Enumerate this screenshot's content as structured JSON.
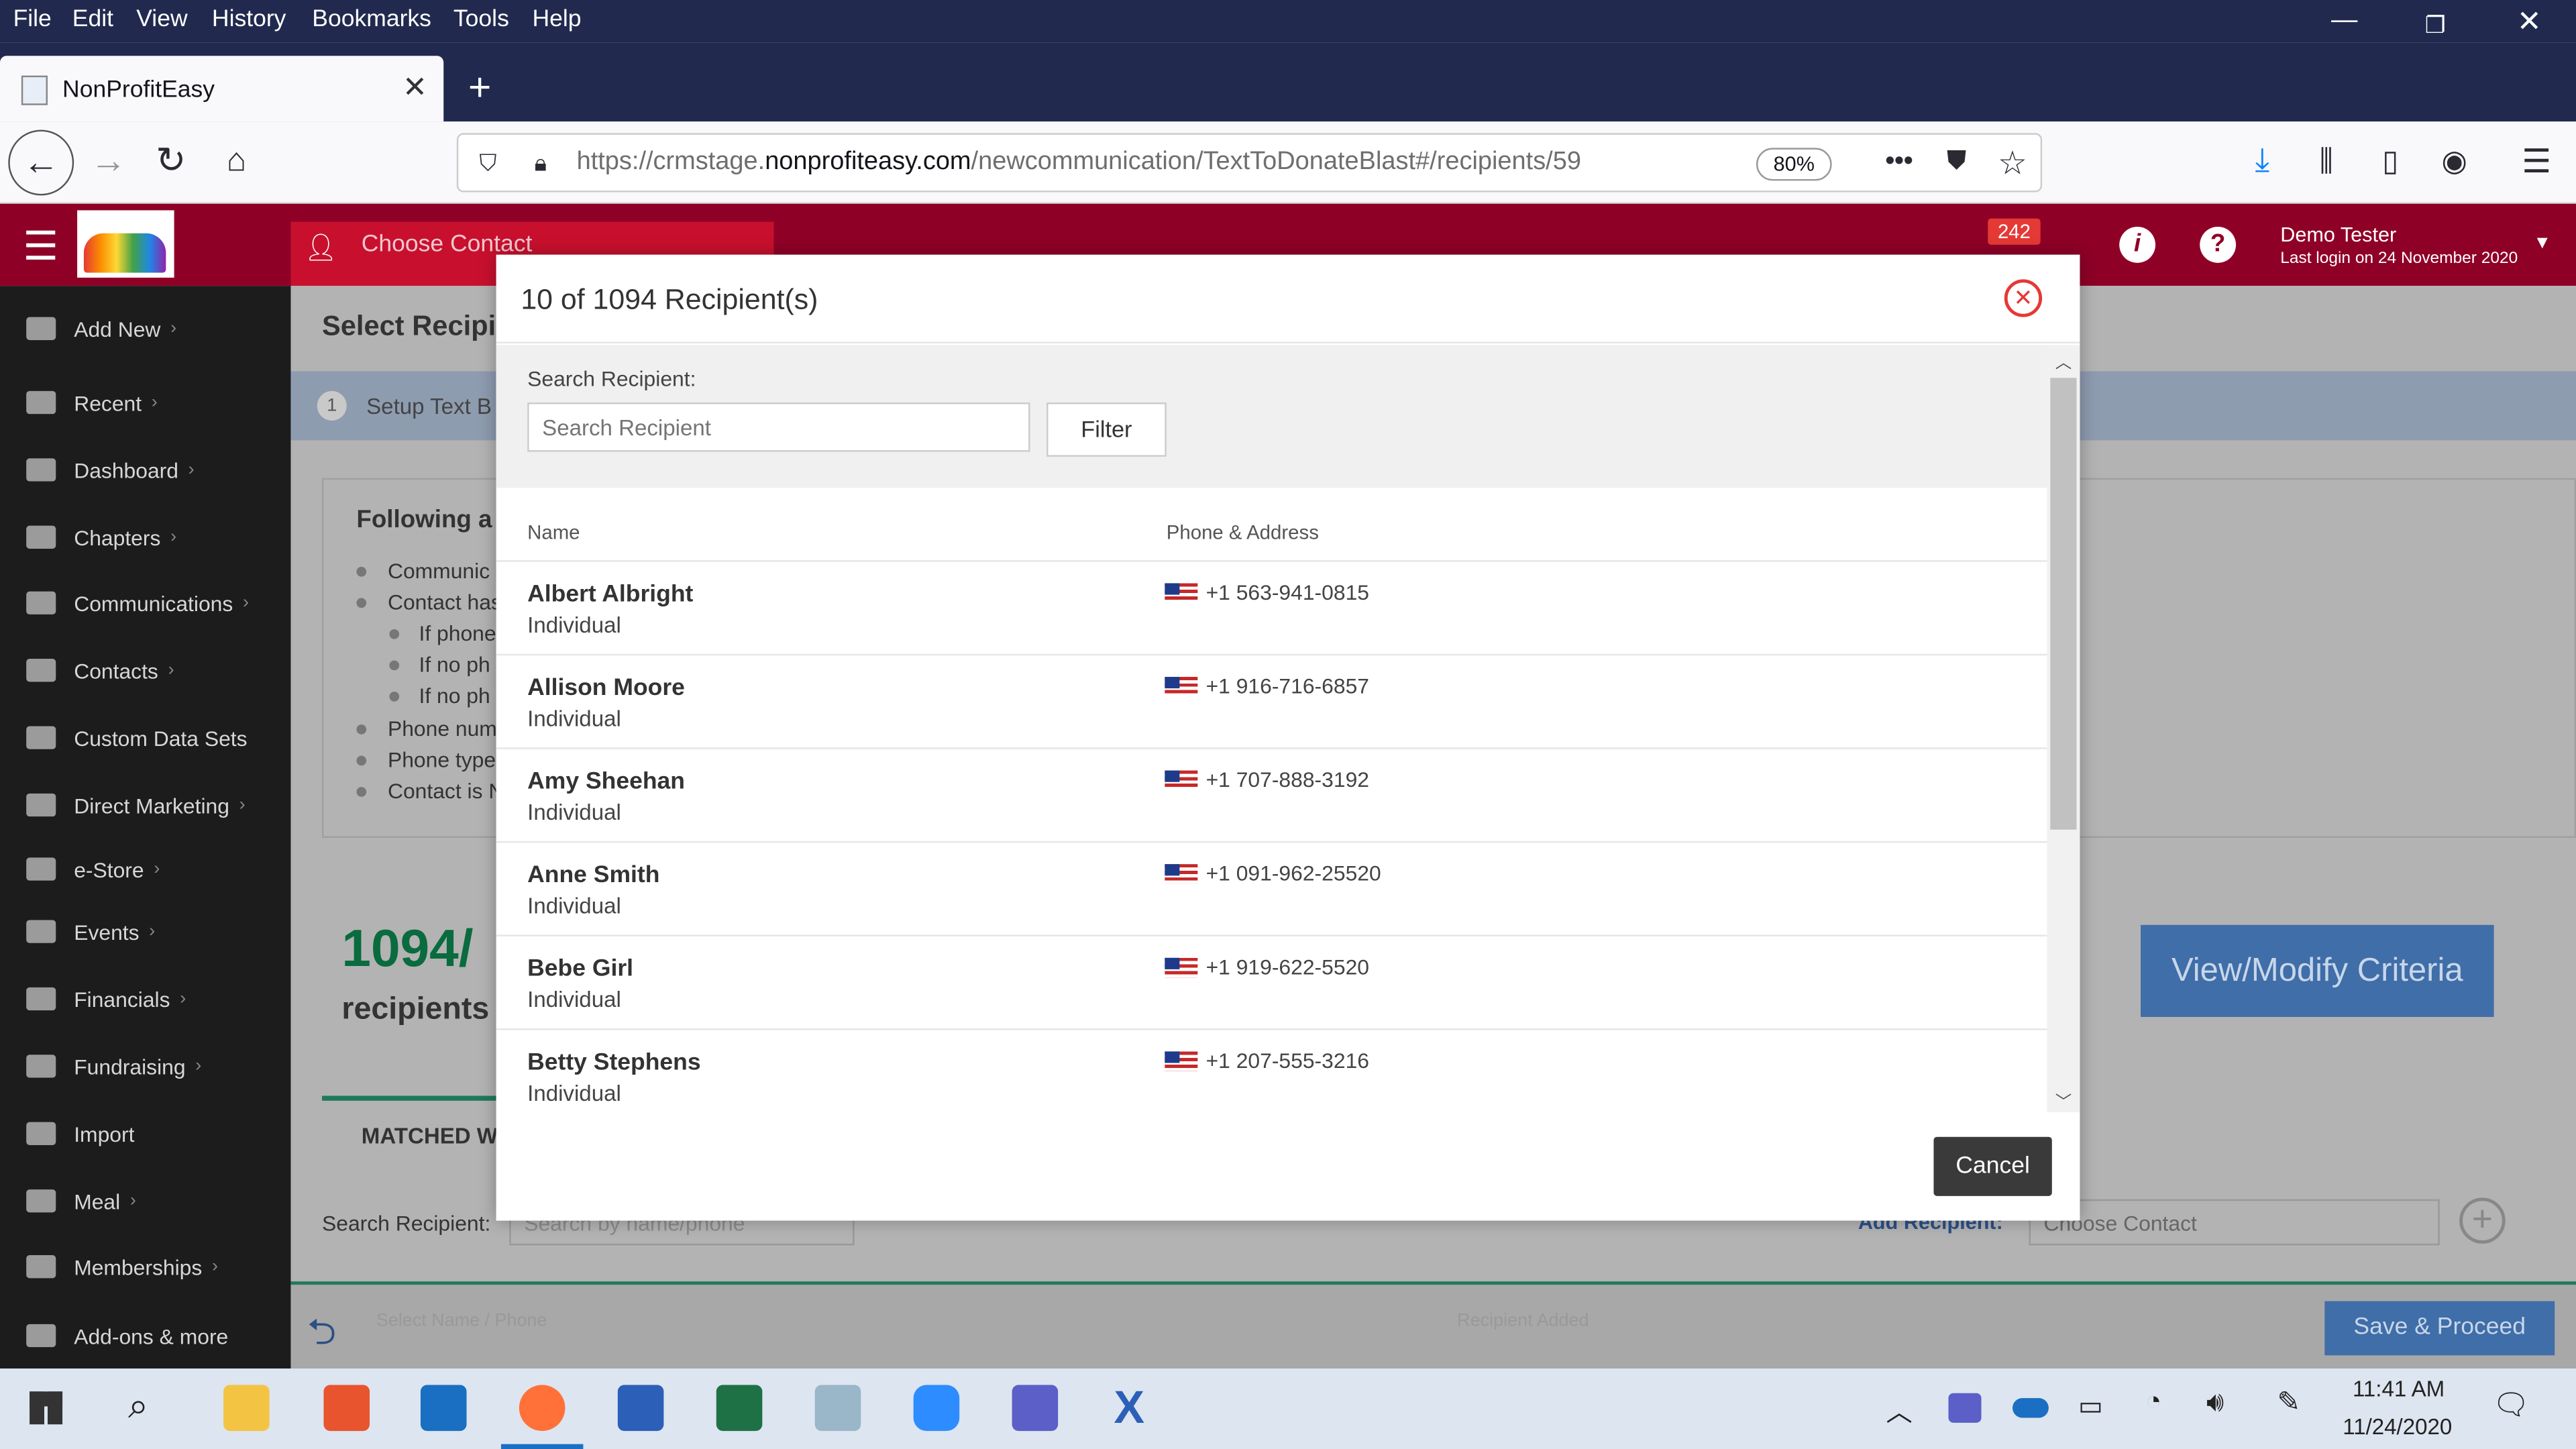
{
  "browser": {
    "menu": [
      "File",
      "Edit",
      "View",
      "History",
      "Bookmarks",
      "Tools",
      "Help"
    ],
    "tab_title": "NonProfitEasy",
    "url_prefix": "https://crmstage.",
    "url_domain": "nonprofiteasy.com",
    "url_path": "/newcommunication/TextToDonateBlast#/recipients/59",
    "zoom": "80%"
  },
  "app": {
    "choose_contact": "Choose Contact",
    "notification_count": "242",
    "user_name": "Demo Tester",
    "last_login": "Last login on 24 November 2020"
  },
  "sidebar": {
    "items": [
      {
        "label": "Add New",
        "chevron": true
      },
      {
        "label": "Recent",
        "chevron": true
      },
      {
        "label": "Dashboard",
        "chevron": true
      },
      {
        "label": "Chapters",
        "chevron": true
      },
      {
        "label": "Communications",
        "chevron": true
      },
      {
        "label": "Contacts",
        "chevron": true
      },
      {
        "label": "Custom Data Sets",
        "chevron": false
      },
      {
        "label": "Direct Marketing",
        "chevron": true
      },
      {
        "label": "e-Store",
        "chevron": true
      },
      {
        "label": "Events",
        "chevron": true
      },
      {
        "label": "Financials",
        "chevron": true
      },
      {
        "label": "Fundraising",
        "chevron": true
      },
      {
        "label": "Import",
        "chevron": false
      },
      {
        "label": "Meal",
        "chevron": true
      },
      {
        "label": "Memberships",
        "chevron": true
      },
      {
        "label": "Add-ons & more",
        "chevron": false
      }
    ]
  },
  "page": {
    "title_partial": "Select Recipi",
    "step_num": "1",
    "step_label": "Setup Text B",
    "following": "Following a",
    "bullets": [
      "Communic",
      "Contact has",
      "If phone",
      "If no ph",
      "If no ph",
      "Phone num",
      "Phone type",
      "Contact is N"
    ],
    "count_big": "1094/",
    "count_label": "recipients",
    "matched_tab": "MATCHED W",
    "search_label": "Search Recipient:",
    "search_placeholder": "Search by name/phone",
    "add_recipient": "Add Recipient:",
    "add_placeholder": "Choose Contact",
    "view_modify": "View/Modify Criteria",
    "footer_left": "Select Name / Phone",
    "footer_mid": "Recipient Added",
    "save_proceed": "Save & Proceed"
  },
  "modal": {
    "title": "10 of 1094 Recipient(s)",
    "search_label": "Search Recipient:",
    "search_placeholder": "Search Recipient",
    "filter_label": "Filter",
    "col_name": "Name",
    "col_phone": "Phone & Address",
    "rows": [
      {
        "name": "Albert Albright",
        "type": "Individual",
        "phone": "+1 563-941-0815"
      },
      {
        "name": "Allison Moore",
        "type": "Individual",
        "phone": "+1 916-716-6857"
      },
      {
        "name": "Amy Sheehan",
        "type": "Individual",
        "phone": "+1 707-888-3192"
      },
      {
        "name": "Anne Smith",
        "type": "Individual",
        "phone": "+1 091-962-25520"
      },
      {
        "name": "Bebe Girl",
        "type": "Individual",
        "phone": "+1 919-622-5520"
      },
      {
        "name": "Betty Stephens",
        "type": "Individual",
        "phone": "+1 207-555-3216"
      }
    ],
    "cancel_label": "Cancel"
  },
  "taskbar": {
    "time": "11:41 AM",
    "date": "11/24/2020"
  }
}
